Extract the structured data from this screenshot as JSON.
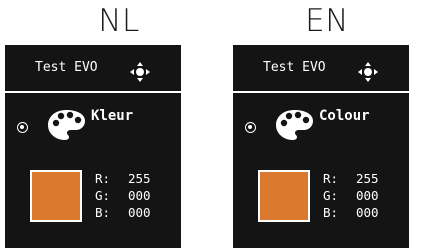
{
  "panels": [
    {
      "language": "NL",
      "screen": {
        "title": "Test EVO",
        "item_label": "Kleur",
        "radio_selected": true,
        "color": {
          "hex": "#db7a2e",
          "r_label": "R:",
          "r": "255",
          "g_label": "G:",
          "g": "000",
          "b_label": "B:",
          "b": "000"
        }
      }
    },
    {
      "language": "EN",
      "screen": {
        "title": "Test EVO",
        "item_label": "Colour",
        "radio_selected": true,
        "color": {
          "hex": "#db7a2e",
          "r_label": "R:",
          "r": "255",
          "g_label": "G:",
          "g": "000",
          "b_label": "B:",
          "b": "000"
        }
      }
    }
  ],
  "icons": {
    "navigation": "four-way-arrows-icon",
    "palette": "palette-icon"
  },
  "colors": {
    "screen_background": "#141414",
    "foreground": "#ffffff",
    "swatch": "#db7a2e"
  }
}
